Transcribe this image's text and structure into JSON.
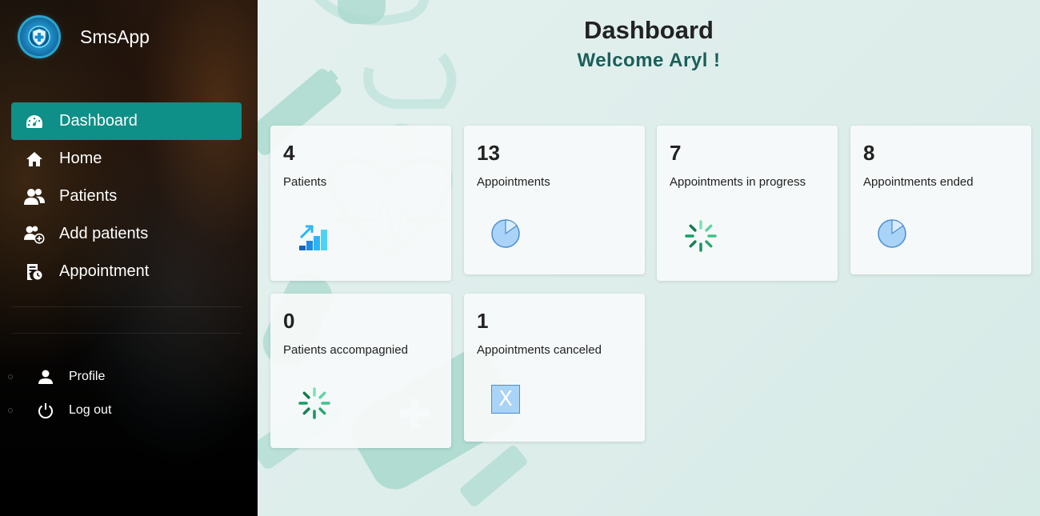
{
  "brand": {
    "name": "SmsApp",
    "logo_icon": "medical-shield-logo"
  },
  "nav": {
    "items": [
      {
        "label": "Dashboard",
        "icon": "speedometer-icon",
        "active": true
      },
      {
        "label": "Home",
        "icon": "home-icon",
        "active": false
      },
      {
        "label": "Patients",
        "icon": "users-icon",
        "active": false
      },
      {
        "label": "Add patients",
        "icon": "add-user-icon",
        "active": false
      },
      {
        "label": "Appointment",
        "icon": "appointment-icon",
        "active": false
      }
    ]
  },
  "sub_nav": {
    "items": [
      {
        "label": "Profile",
        "icon": "person-icon"
      },
      {
        "label": "Log out",
        "icon": "power-icon"
      }
    ]
  },
  "header": {
    "title": "Dashboard",
    "welcome": "Welcome Aryl !"
  },
  "cards": [
    {
      "value": "4",
      "label": "Patients",
      "icon": "growth-chart-icon"
    },
    {
      "value": "13",
      "label": "Appointments",
      "icon": "pie-icon"
    },
    {
      "value": "7",
      "label": "Appointments in progress",
      "icon": "spinner-icon"
    },
    {
      "value": "8",
      "label": "Appointments ended",
      "icon": "pie-icon"
    },
    {
      "value": "0",
      "label": "Patients accompagnied",
      "icon": "spinner-icon"
    },
    {
      "value": "1",
      "label": "Appointments canceled",
      "icon": "cancel-box-icon",
      "glyph": "X"
    }
  ],
  "colors": {
    "accent": "#0e8f87",
    "welcome_text": "#1b5e5a",
    "pie_fill": "#a9d3f7",
    "spinner": "#1fa06a"
  }
}
